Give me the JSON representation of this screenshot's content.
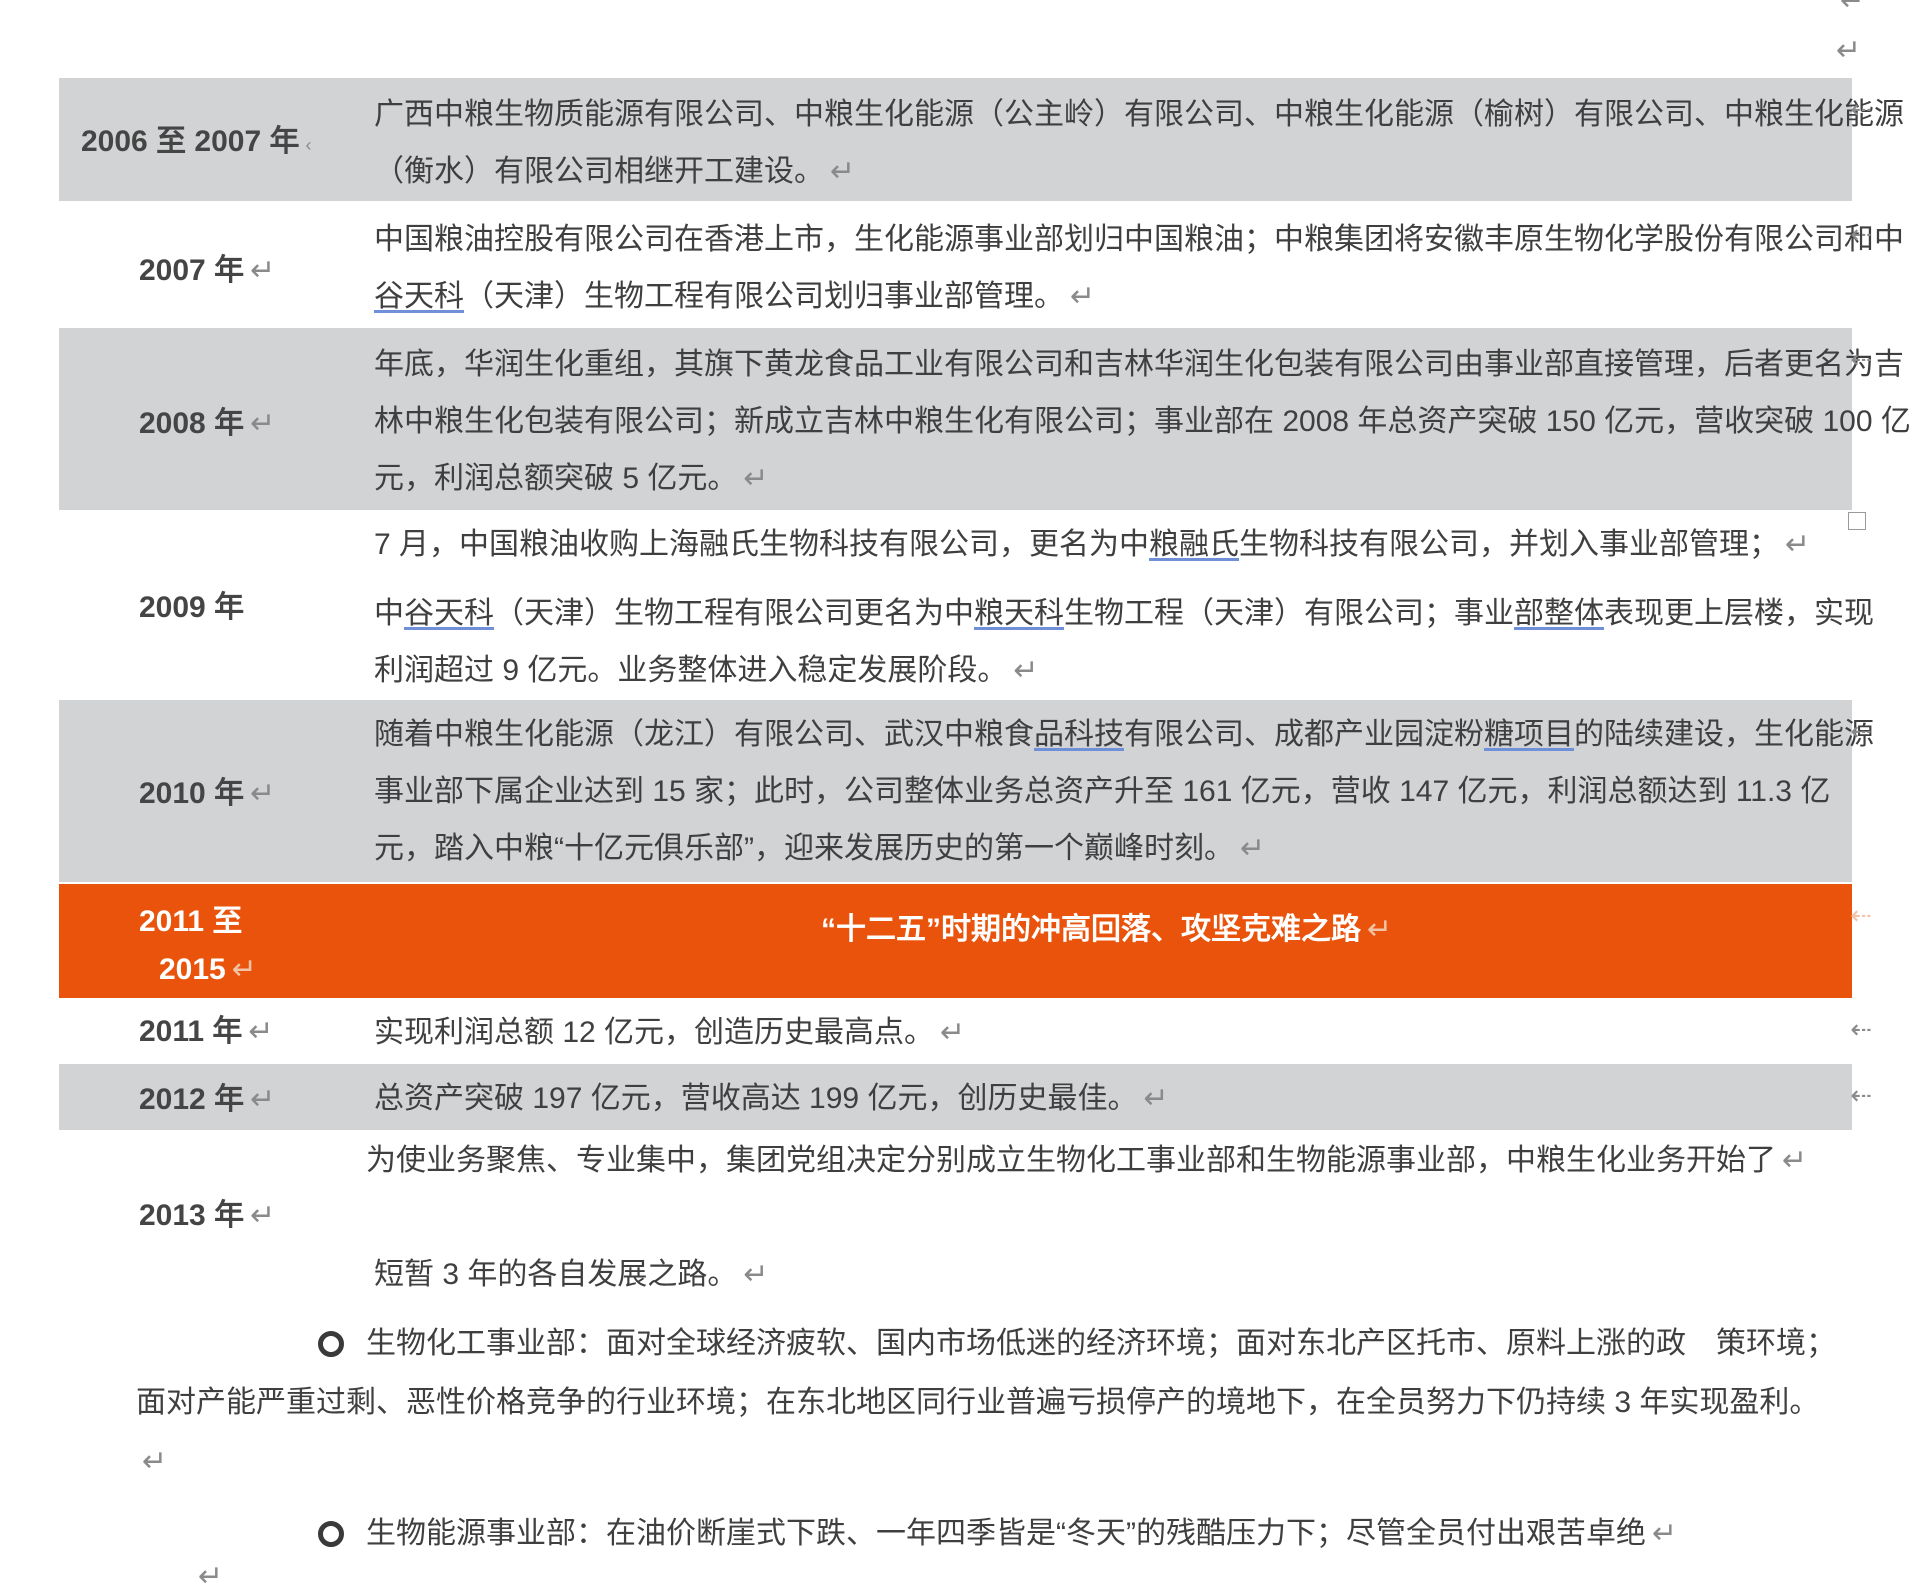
{
  "return_mark": "↵",
  "rows": [
    {
      "year": "2006 至 2007 年",
      "text": "广西中粮生物质能源有限公司、中粮生化能源（公主岭）有限公司、中粮生化能源（榆树）有限公司、中粮生化能源（衡水）有限公司相继开工建设。"
    },
    {
      "year": "2007 年",
      "text_before_ul": "中国粮油控股有限公司在香港上市，生化能源事业部划归中国粮油；中粮集团将安徽丰原生物化学股份有限公司和中",
      "text_ul": "谷天科",
      "text_after_ul": "（天津）生物工程有限公司划归事业部管理。"
    },
    {
      "year": "2008 年",
      "text": "年底，华润生化重组，其旗下黄龙食品工业有限公司和吉林华润生化包装有限公司由事业部直接管理，后者更名为吉林中粮生化包装有限公司；新成立吉林中粮生化有限公司；事业部在 2008 年总资产突破 150 亿元，营收突破 100 亿元，利润总额突破 5 亿元。"
    },
    {
      "year": "2009 年",
      "line1_a": "7 月，中国粮油收购上海融氏生物科技有限公司，更名为中",
      "line1_ul": "粮融氏",
      "line1_b": "生物科技有限公司，并划入事业部管理；",
      "line2_a": "中",
      "line2_ul1": "谷天科",
      "line2_b": "（天津）生物工程有限公司更名为中",
      "line2_ul2": "粮天科",
      "line2_c": "生物工程（天津）有限公司；事业",
      "line2_ul3": "部整体",
      "line2_d": "表现更上层楼，实现利润超过 9 亿元。业务整体进入稳定发展阶段。"
    },
    {
      "year": "2010 年",
      "text_a": "随着中粮生化能源（龙江）有限公司、武汉中粮食",
      "text_ul1": "品科技",
      "text_b": "有限公司、成都产业园淀粉",
      "text_ul2": "糖项目",
      "text_c": "的陆续建设，生化能源事业部下属企业达到 15 家；此时，公司整体业务总资产升至 161 亿元，营收 147 亿元，利润总额达到 11.3 亿元，踏入中粮“十亿元俱乐部”，迎来发展历史的第一个巅峰时刻。"
    },
    {
      "year_line1": "2011 至",
      "year_line2": "2015",
      "title": "“十二五”时期的冲高回落、攻坚克难之路"
    },
    {
      "year": "2011 年",
      "text": "实现利润总额 12 亿元，创造历史最高点。"
    },
    {
      "year": "2012 年",
      "text": "总资产突破 197 亿元，营收高达 199 亿元，创历史最佳。"
    },
    {
      "year": "2013 年",
      "line1": "为使业务聚焦、专业集中，集团党组决定分别成立生物化工事业部和生物能源事业部，中粮生化业务开始了",
      "line2": "短暂 3 年的各自发展之路。"
    }
  ],
  "bullets": [
    {
      "text": "生物化工事业部：面对全球经济疲软、国内市场低迷的经济环境；面对东北产区托市、原料上涨的政　策环境；面对产能严重过剩、恶性价格竞争的行业环境；在东北地区同行业普遍亏损停产的境地下，在全员努力下仍持续 3 年实现盈利。"
    },
    {
      "text": "生物能源事业部：在油价断崖式下跌、一年四季皆是“冬天”的残酷压力下；尽管全员付出艰苦卓绝"
    }
  ]
}
